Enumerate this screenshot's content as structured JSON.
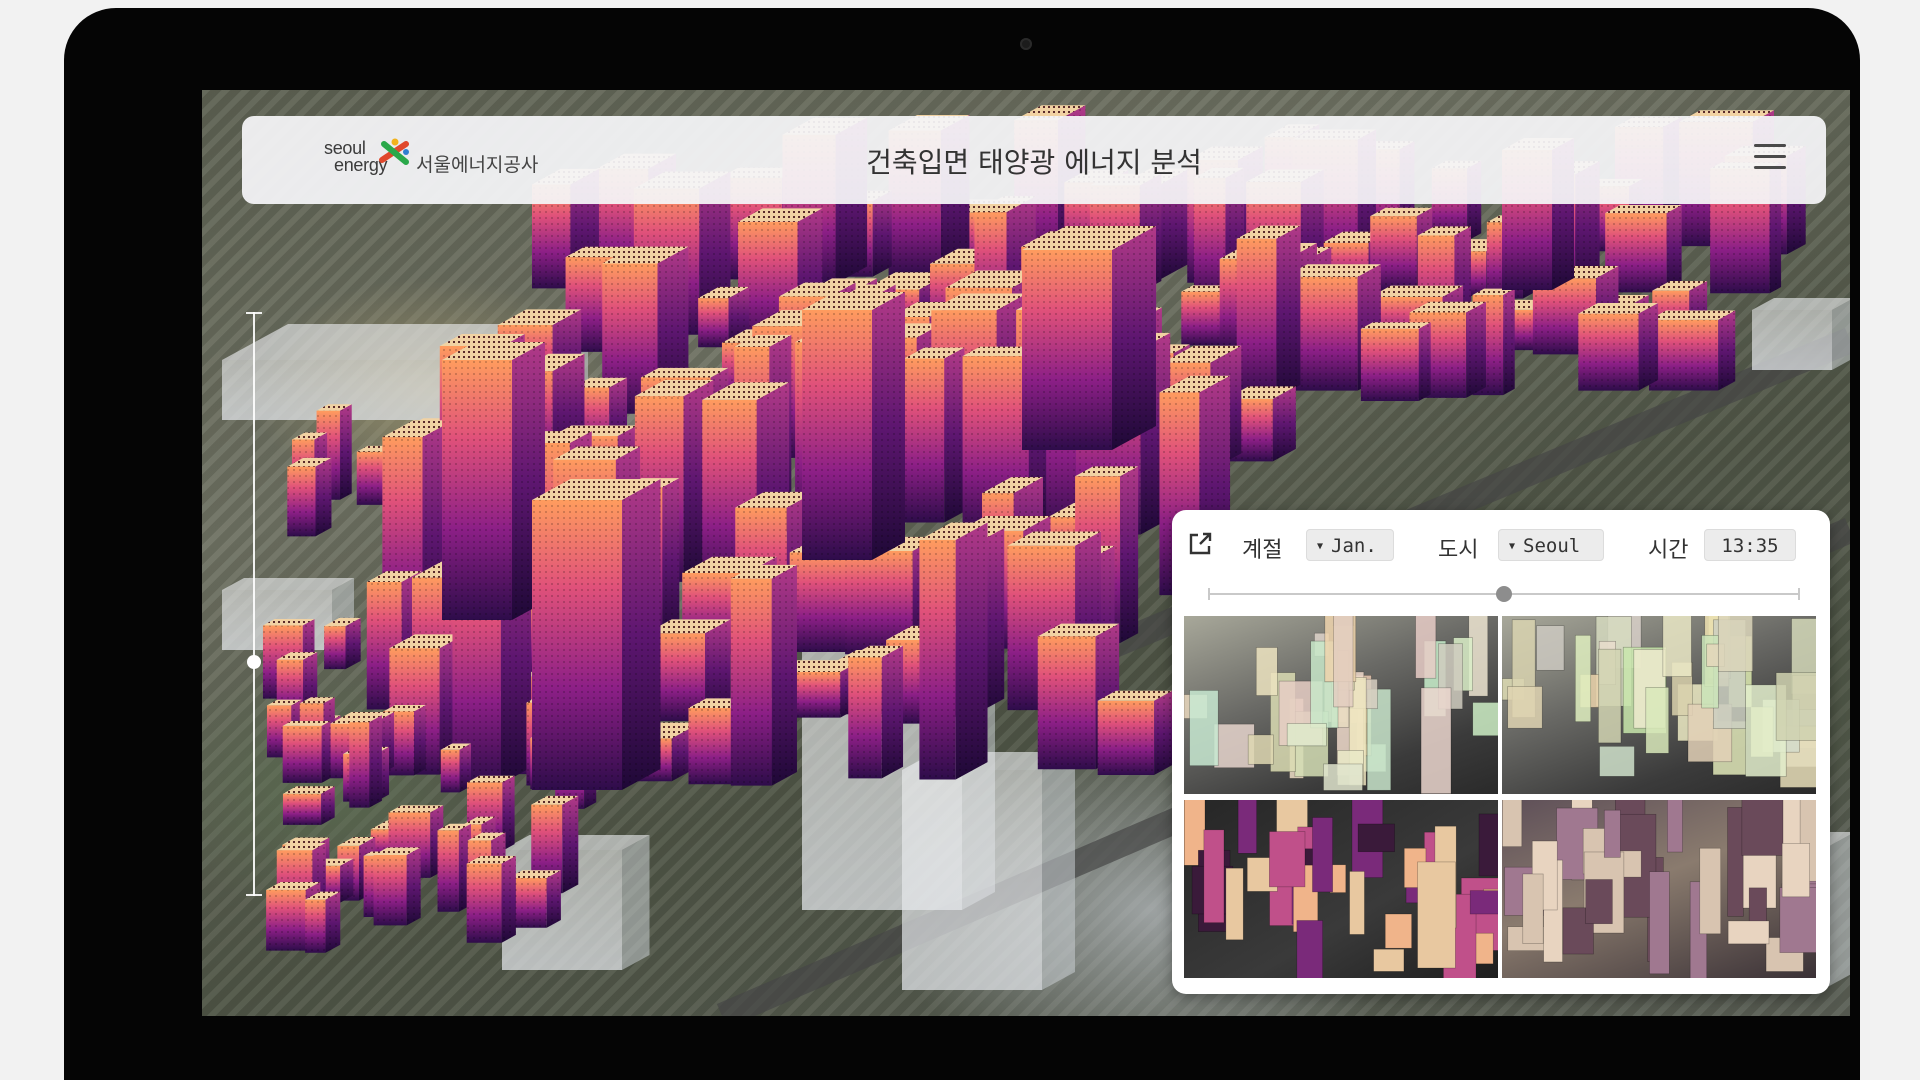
{
  "header": {
    "brand_en_line1": "seoul",
    "brand_en_line2": "energy",
    "brand_ko": "서울에너지공사",
    "title": "건축입면 태양광 에너지 분석"
  },
  "icons": [
    "brand-logo-mark",
    "menu-icon",
    "external-link-icon"
  ],
  "panel": {
    "season_label": "계절",
    "season_value": "Jan.",
    "city_label": "도시",
    "city_value": "Seoul",
    "time_label": "시간",
    "time_value": "13:35",
    "time_slider_fraction": 0.5
  },
  "map": {
    "height_slider_fraction": 0.6
  },
  "colors": {
    "building_low": "#3a1050",
    "building_mid": "#b02a8c",
    "building_high": "#ff9a5c",
    "building_top": "#f0d0a0",
    "bezel": "#050505",
    "header_bg": "#f4f4f6"
  }
}
